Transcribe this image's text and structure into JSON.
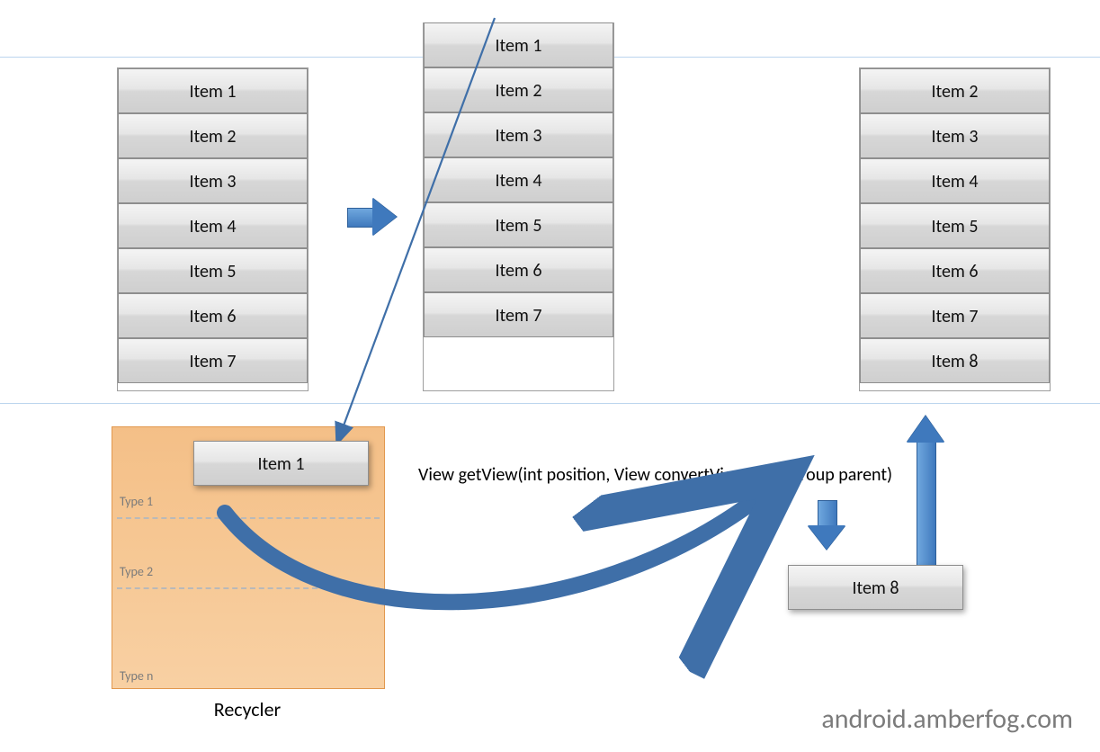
{
  "lists": {
    "left": [
      "Item 1",
      "Item 2",
      "Item 3",
      "Item 4",
      "Item 5",
      "Item 6",
      "Item 7"
    ],
    "middle": [
      "Item 1",
      "Item 2",
      "Item 3",
      "Item 4",
      "Item 5",
      "Item 6",
      "Item 7"
    ],
    "right": [
      "Item 2",
      "Item 3",
      "Item 4",
      "Item 5",
      "Item 6",
      "Item 7",
      "Item 8"
    ]
  },
  "floating": {
    "recycled_item": "Item 1",
    "new_item": "Item 8"
  },
  "recycler": {
    "type1": "Type 1",
    "type2": "Type 2",
    "typen": "Type n"
  },
  "labels": {
    "method": "View getView(int position, View convertView, ViewGroup parent)",
    "recycler_title": "Recycler",
    "watermark": "android.amberfog.com"
  }
}
